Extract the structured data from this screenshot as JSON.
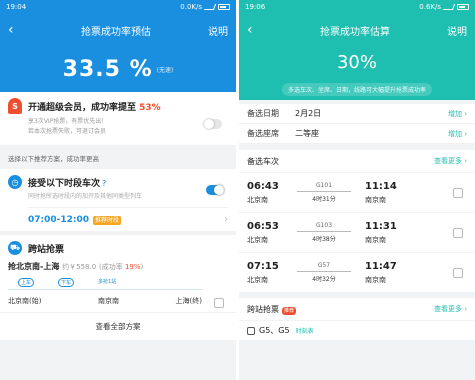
{
  "left": {
    "status_time": "19:04",
    "status_net": "0.0K/s",
    "title": "抢票成功率预估",
    "nav_right": "说明",
    "rate_value": "33.5 %",
    "rate_note": "(无速)",
    "vip_headline_prefix": "开通超级会员，成功率提至 ",
    "vip_headline_value": "53%",
    "vip_sub1": "享3次VIP抢票，有票优先出！",
    "vip_sub2": "若本次抢票失败，可退订会员",
    "recommend_hint": "选择以下推荐方案，成功率更高",
    "section1_title": "接受以下时段车次",
    "section1_sub": "同时抢所选时段内的加开及其他同类型列车",
    "time_range": "07:00-12:00",
    "time_tag": "推荐时段",
    "section2_title": "跨站抢票",
    "route_text": "抢北京南-上海",
    "route_price": "约￥558.0",
    "route_rate_label": "(成功率 ",
    "route_rate_value": "19%",
    "route_rate_end": ")",
    "pill_up": "上车",
    "pill_down": "下车",
    "pill_extra": "多抢1站",
    "stop1": "北京南(始)",
    "stop2": "南京南",
    "stop3": "上海(终)",
    "view_all": "查看全部方案"
  },
  "right": {
    "status_time": "19:06",
    "status_net": "0.6K/s",
    "title": "抢票成功率估算",
    "nav_right": "说明",
    "rate_value": "30%",
    "hint": "多选车次、坐席、日期，线路可大幅提升抢票成功率",
    "date_label": "备选日期",
    "date_value": "2月2日",
    "seat_label": "备选座席",
    "seat_value": "二等座",
    "add_label": "增加",
    "trains_label": "备选车次",
    "view_more": "查看更多",
    "trains": [
      {
        "dep": "06:43",
        "arr": "11:14",
        "from": "北京南",
        "to": "南京南",
        "no": "G101",
        "dur": "4时31分"
      },
      {
        "dep": "06:53",
        "arr": "11:31",
        "from": "北京南",
        "to": "南京南",
        "no": "G103",
        "dur": "4时38分"
      },
      {
        "dep": "07:15",
        "arr": "11:47",
        "from": "北京南",
        "to": "南京南",
        "no": "G57",
        "dur": "4时32分"
      }
    ],
    "cross_label": "跨站抢票",
    "cross_badge": "推荐",
    "g5_label": "G5、G5",
    "g5_schedule": "时刻表"
  }
}
